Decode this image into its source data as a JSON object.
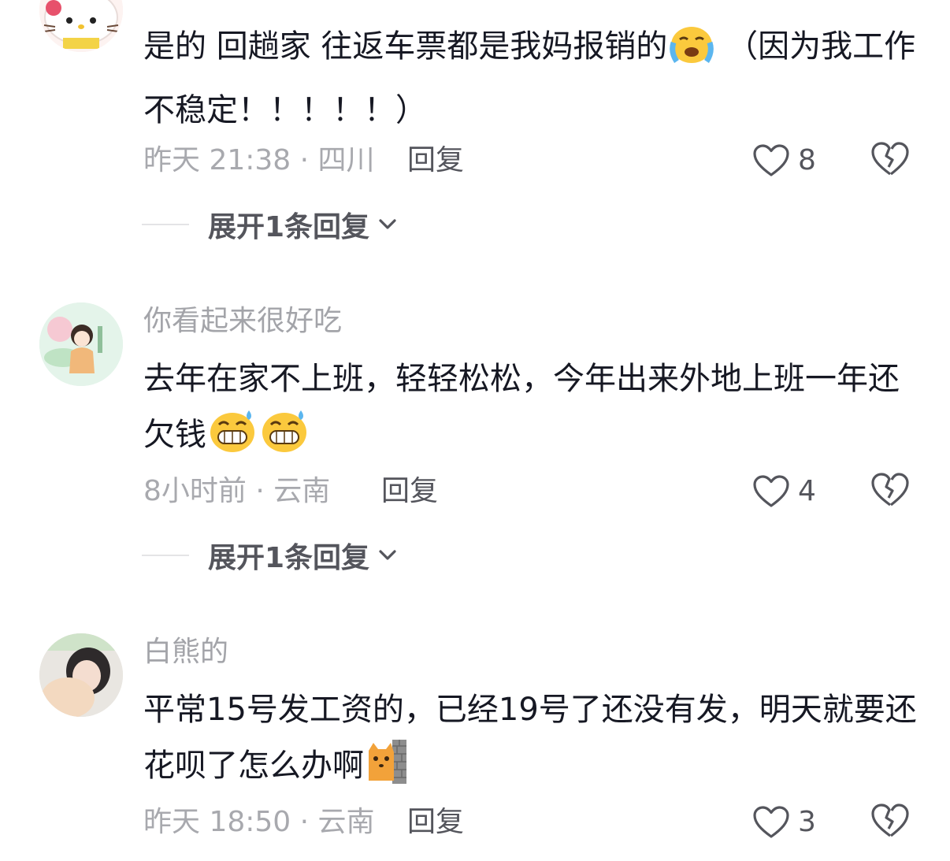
{
  "comments": [
    {
      "username": "",
      "text_part1": "是的 回趟家 往返车票都是我妈报销的",
      "emoji1": "crying-face-emoji",
      "text_part2": " （因为我工作不稳定！！！！！）",
      "time_location": "昨天 21:38 · 四川",
      "reply_label": "回复",
      "like_count": "8",
      "expand_label": "展开1条回复"
    },
    {
      "username": "你看起来很好吃",
      "text": "去年在家不上班，轻轻松松，今年出来外地上班一年还欠钱",
      "emojis": [
        "grinning-sweat-emoji",
        "grinning-sweat-emoji"
      ],
      "time_location": "8小时前 · 云南",
      "reply_label": "回复",
      "like_count": "4",
      "expand_label": "展开1条回复"
    },
    {
      "username": "白熊的",
      "text": "平常15号发工资的，已经19号了还没有发，明天就要还花呗了怎么办啊",
      "emojis": [
        "cat-peeking-wall-emoji"
      ],
      "time_location": "昨天 18:50 · 云南",
      "reply_label": "回复",
      "like_count": "3"
    }
  ],
  "icons": {
    "like": "heart-outline-icon",
    "dislike": "broken-heart-icon",
    "expand": "chevron-down-icon"
  },
  "colors": {
    "text_primary": "#161823",
    "text_secondary": "#a8a9ae",
    "action": "#54555c",
    "background": "#ffffff"
  }
}
